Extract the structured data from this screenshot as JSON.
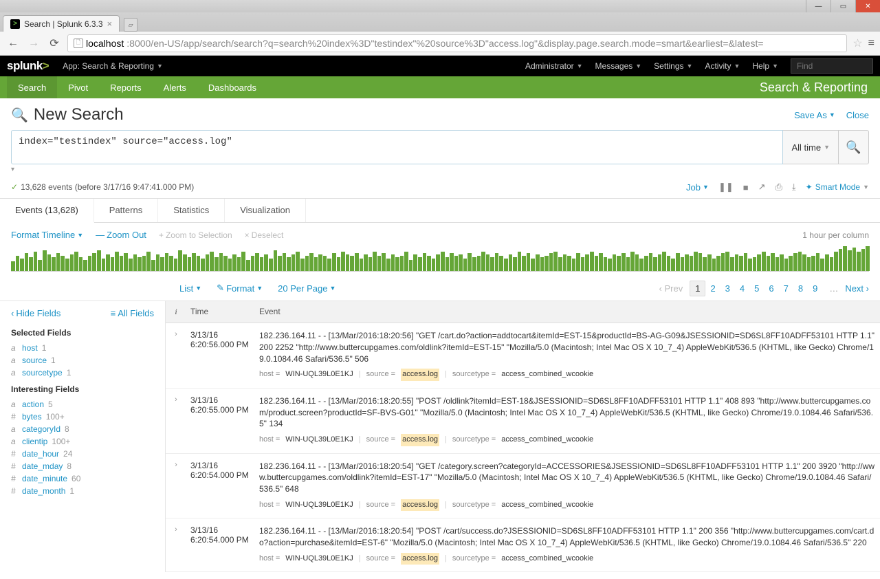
{
  "browser": {
    "tab_title": "Search | Splunk 6.3.3",
    "url_host": "localhost",
    "url_path": ":8000/en-US/app/search/search?q=search%20index%3D\"testindex\"%20source%3D\"access.log\"&display.page.search.mode=smart&earliest=&latest="
  },
  "topbar": {
    "logo": "splunk",
    "app_menu": "App: Search & Reporting",
    "links": [
      "Administrator",
      "Messages",
      "Settings",
      "Activity",
      "Help"
    ],
    "find_placeholder": "Find"
  },
  "nav": {
    "items": [
      "Search",
      "Pivot",
      "Reports",
      "Alerts",
      "Dashboards"
    ],
    "app_title": "Search & Reporting"
  },
  "search": {
    "title": "New Search",
    "save_as": "Save As",
    "close": "Close",
    "query": "index=\"testindex\" source=\"access.log\"",
    "time_label": "All time"
  },
  "status": {
    "text": "13,628 events (before 3/17/16 9:47:41.000 PM)",
    "job": "Job",
    "smart_mode": "Smart Mode"
  },
  "tabs": {
    "events": "Events (13,628)",
    "patterns": "Patterns",
    "statistics": "Statistics",
    "visualization": "Visualization"
  },
  "timeline": {
    "format": "Format Timeline",
    "zoom_out": "Zoom Out",
    "zoom_sel": "Zoom to Selection",
    "deselect": "Deselect",
    "scale": "1 hour per column"
  },
  "list_controls": {
    "list": "List",
    "format": "Format",
    "per_page": "20 Per Page"
  },
  "pager": {
    "prev": "Prev",
    "pages": [
      "1",
      "2",
      "3",
      "4",
      "5",
      "6",
      "7",
      "8",
      "9"
    ],
    "next": "Next"
  },
  "fields": {
    "hide": "Hide Fields",
    "all": "All Fields",
    "selected_h": "Selected Fields",
    "selected": [
      {
        "t": "a",
        "n": "host",
        "c": "1"
      },
      {
        "t": "a",
        "n": "source",
        "c": "1"
      },
      {
        "t": "a",
        "n": "sourcetype",
        "c": "1"
      }
    ],
    "interesting_h": "Interesting Fields",
    "interesting": [
      {
        "t": "a",
        "n": "action",
        "c": "5"
      },
      {
        "t": "#",
        "n": "bytes",
        "c": "100+"
      },
      {
        "t": "a",
        "n": "categoryId",
        "c": "8"
      },
      {
        "t": "a",
        "n": "clientip",
        "c": "100+"
      },
      {
        "t": "#",
        "n": "date_hour",
        "c": "24"
      },
      {
        "t": "#",
        "n": "date_mday",
        "c": "8"
      },
      {
        "t": "#",
        "n": "date_minute",
        "c": "60"
      },
      {
        "t": "#",
        "n": "date_month",
        "c": "1"
      }
    ]
  },
  "events_table": {
    "col_i": "i",
    "col_time": "Time",
    "col_event": "Event",
    "rows": [
      {
        "date": "3/13/16",
        "time": "6:20:56.000 PM",
        "raw": "182.236.164.11 - - [13/Mar/2016:18:20:56] \"GET /cart.do?action=addtocart&itemId=EST-15&productId=BS-AG-G09&JSESSIONID=SD6SL8FF10ADFF53101 HTTP 1.1\" 200 2252 \"http://www.buttercupgames.com/oldlink?itemId=EST-15\" \"Mozilla/5.0 (Macintosh; Intel Mac OS X 10_7_4) AppleWebKit/536.5 (KHTML, like Gecko) Chrome/19.0.1084.46 Safari/536.5\" 506",
        "host": "WIN-UQL39L0E1KJ",
        "source": "access.log",
        "sourcetype": "access_combined_wcookie"
      },
      {
        "date": "3/13/16",
        "time": "6:20:55.000 PM",
        "raw": "182.236.164.11 - - [13/Mar/2016:18:20:55] \"POST /oldlink?itemId=EST-18&JSESSIONID=SD6SL8FF10ADFF53101 HTTP 1.1\" 408 893 \"http://www.buttercupgames.com/product.screen?productId=SF-BVS-G01\" \"Mozilla/5.0 (Macintosh; Intel Mac OS X 10_7_4) AppleWebKit/536.5 (KHTML, like Gecko) Chrome/19.0.1084.46 Safari/536.5\" 134",
        "host": "WIN-UQL39L0E1KJ",
        "source": "access.log",
        "sourcetype": "access_combined_wcookie"
      },
      {
        "date": "3/13/16",
        "time": "6:20:54.000 PM",
        "raw": "182.236.164.11 - - [13/Mar/2016:18:20:54] \"GET /category.screen?categoryId=ACCESSORIES&JSESSIONID=SD6SL8FF10ADFF53101 HTTP 1.1\" 200 3920 \"http://www.buttercupgames.com/oldlink?itemId=EST-17\" \"Mozilla/5.0 (Macintosh; Intel Mac OS X 10_7_4) AppleWebKit/536.5 (KHTML, like Gecko) Chrome/19.0.1084.46 Safari/536.5\" 648",
        "host": "WIN-UQL39L0E1KJ",
        "source": "access.log",
        "sourcetype": "access_combined_wcookie"
      },
      {
        "date": "3/13/16",
        "time": "6:20:54.000 PM",
        "raw": "182.236.164.11 - - [13/Mar/2016:18:20:54] \"POST /cart/success.do?JSESSIONID=SD6SL8FF10ADFF53101 HTTP 1.1\" 200 356 \"http://www.buttercupgames.com/cart.do?action=purchase&itemId=EST-6\" \"Mozilla/5.0 (Macintosh; Intel Mac OS X 10_7_4) AppleWebKit/536.5 (KHTML, like Gecko) Chrome/19.0.1084.46 Safari/536.5\" 220",
        "host": "WIN-UQL39L0E1KJ",
        "source": "access.log",
        "sourcetype": "access_combined_wcookie"
      }
    ]
  },
  "timeline_bars": [
    14,
    22,
    18,
    26,
    20,
    28,
    16,
    30,
    24,
    20,
    26,
    22,
    18,
    24,
    28,
    20,
    16,
    22,
    26,
    30,
    18,
    24,
    20,
    28,
    22,
    26,
    18,
    24,
    20,
    22,
    28,
    16,
    24,
    20,
    26,
    22,
    18,
    30,
    24,
    20,
    26,
    22,
    18,
    24,
    28,
    20,
    26,
    22,
    18,
    24,
    20,
    28,
    16,
    22,
    26,
    20,
    24,
    18,
    30,
    22,
    26,
    20,
    24,
    28,
    18,
    22,
    26,
    20,
    24,
    22,
    18,
    26,
    20,
    28,
    24,
    22,
    26,
    18,
    24,
    20,
    28,
    22,
    26,
    18,
    24,
    20,
    22,
    28,
    16,
    24,
    20,
    26,
    22,
    18,
    24,
    28,
    20,
    26,
    22,
    24,
    18,
    26,
    20,
    22,
    28,
    24,
    20,
    26,
    22,
    18,
    24,
    20,
    28,
    22,
    26,
    18,
    24,
    20,
    22,
    26,
    28,
    20,
    24,
    22,
    18,
    26,
    20,
    24,
    28,
    22,
    26,
    20,
    18,
    24,
    22,
    26,
    20,
    28,
    24,
    18,
    22,
    26,
    20,
    24,
    28,
    22,
    18,
    26,
    20,
    24,
    22,
    28,
    26,
    20,
    24,
    18,
    22,
    26,
    28,
    20,
    24,
    22,
    26,
    18,
    20,
    24,
    28,
    22,
    26,
    20,
    24,
    18,
    22,
    26,
    28,
    24,
    20,
    22,
    26,
    18,
    24,
    20,
    28,
    32,
    36,
    30,
    34,
    28,
    32,
    36
  ]
}
